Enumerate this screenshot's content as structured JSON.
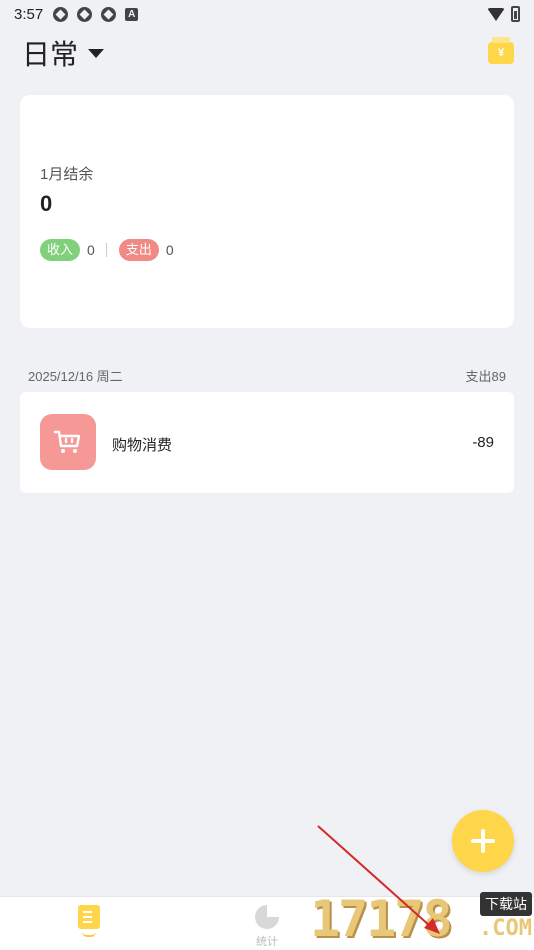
{
  "status_bar": {
    "time": "3:57",
    "notification_icons": [
      "app-icon",
      "app-icon",
      "app-icon",
      "a-icon"
    ],
    "a_glyph": "A"
  },
  "header": {
    "book_title": "日常",
    "wallet_glyph": "¥"
  },
  "summary": {
    "label": "1月结余",
    "value": "0",
    "income_label": "收入",
    "income_value": "0",
    "expense_label": "支出",
    "expense_value": "0"
  },
  "day_group": {
    "date": "2025/12/16 周二",
    "total": "支出89"
  },
  "transactions": [
    {
      "name": "购物消费",
      "amount": "-89",
      "icon": "shopping-cart-icon",
      "icon_color": "#f59896"
    }
  ],
  "tabs": [
    {
      "label": "",
      "icon": "records-icon",
      "active": true
    },
    {
      "label": "统计",
      "icon": "pie-chart-icon",
      "active": false
    }
  ],
  "watermark": {
    "digits": "17178",
    "badge": "下载站",
    "suffix": ".COM"
  },
  "colors": {
    "accent": "#ffd54a",
    "income": "#82d07b",
    "expense": "#f08a85",
    "background": "#f0f1f5"
  }
}
